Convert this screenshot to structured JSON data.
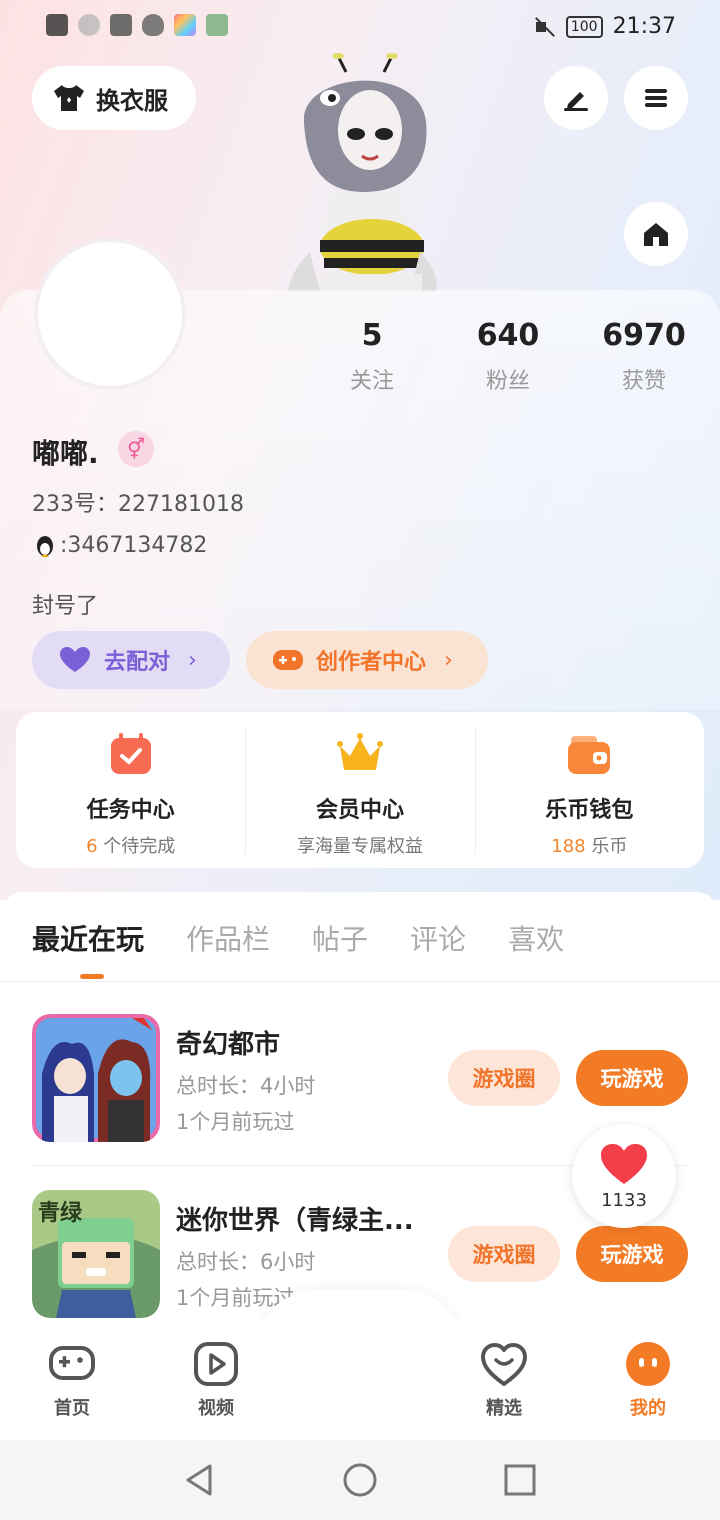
{
  "status_bar": {
    "time": "21:37",
    "battery": "100"
  },
  "header": {
    "dress_label": "换衣服"
  },
  "profile": {
    "stats": [
      {
        "num": "5",
        "label": "关注"
      },
      {
        "num": "640",
        "label": "粉丝"
      },
      {
        "num": "6970",
        "label": "获赞"
      }
    ],
    "nickname": "嘟嘟.",
    "gender_symbol": "⚥",
    "id_line": "233号：227181018",
    "qq_line": ":3467134782",
    "bio": "封号了",
    "match_label": "去配对",
    "creator_label": "创作者中心"
  },
  "quick": [
    {
      "title": "任务中心",
      "sub_hl": "6",
      "sub": " 个待完成"
    },
    {
      "title": "会员中心",
      "sub_hl": "",
      "sub": "享海量专属权益"
    },
    {
      "title": "乐币钱包",
      "sub_hl": "188",
      "sub": " 乐币"
    }
  ],
  "tabs": [
    "最近在玩",
    "作品栏",
    "帖子",
    "评论",
    "喜欢"
  ],
  "games": [
    {
      "name": "奇幻都市",
      "duration": "总时长：4小时",
      "last": "1个月前玩过",
      "circle_label": "游戏圈",
      "play_label": "玩游戏"
    },
    {
      "name": "迷你世界（青绿主...",
      "duration": "总时长：6小时",
      "last": "1个月前玩过",
      "circle_label": "游戏圈",
      "play_label": "玩游戏"
    }
  ],
  "like_count": "1133",
  "nav": [
    "首页",
    "视频",
    "精选",
    "我的"
  ],
  "colors": {
    "accent": "#f47b25",
    "match": "#7a60d6"
  }
}
